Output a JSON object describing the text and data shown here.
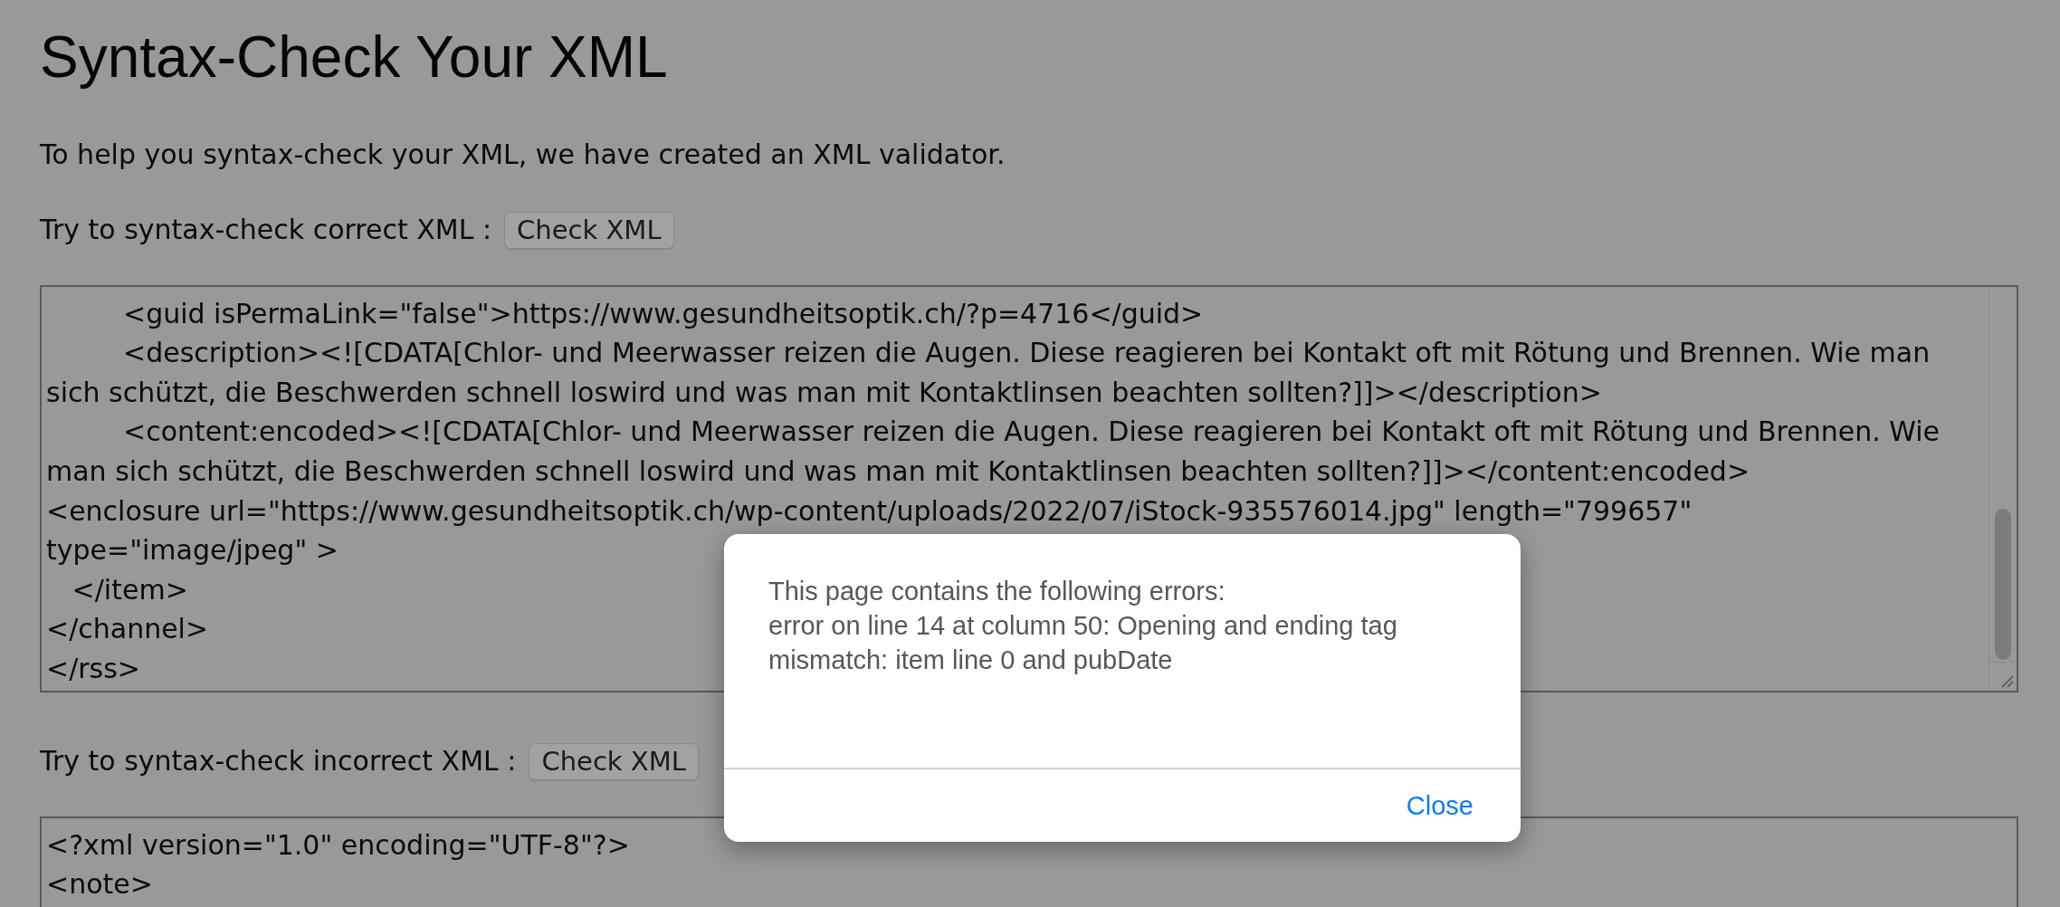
{
  "title": "Syntax-Check Your XML",
  "intro": "To help you syntax-check your XML, we have created an XML validator.",
  "checks": [
    {
      "label": "Try to syntax-check correct XML :",
      "button": "Check XML",
      "editor": {
        "scrollbar": true,
        "lines": [
          "\t<guid isPermaLink=\"false\">https://www.gesundheitsoptik.ch/?p=4716</guid>",
          "\t<description><![CDATA[Chlor- und Meerwasser reizen die Augen. Diese reagieren bei Kontakt oft mit Rötung und Brennen. Wie man",
          "sich schützt, die Beschwerden schnell loswird und was man mit Kontaktlinsen beachten sollten?]]></description>",
          "\t<content:encoded><![CDATA[Chlor- und Meerwasser reizen die Augen. Diese reagieren bei Kontakt oft mit Rötung und Brennen. Wie",
          "man sich schützt, die Beschwerden schnell loswird und was man mit Kontaktlinsen beachten sollten?]]></content:encoded>",
          "<enclosure url=\"https://www.gesundheitsoptik.ch/wp-content/uploads/2022/07/iStock-935576014.jpg\" length=\"799657\"",
          "type=\"image/jpeg\" >",
          "   </item>",
          "</channel>",
          "</rss>"
        ]
      }
    },
    {
      "label": "Try to syntax-check incorrect XML :",
      "button": "Check XML",
      "editor": {
        "scrollbar": false,
        "lines": [
          "<?xml version=\"1.0\" encoding=\"UTF-8\"?>",
          "<note>"
        ]
      }
    }
  ],
  "dialog": {
    "message": "This page contains the following errors:",
    "error": "error on line 14 at column 50: Opening and ending tag mismatch: item line 0 and pubDate",
    "button": "Close"
  }
}
